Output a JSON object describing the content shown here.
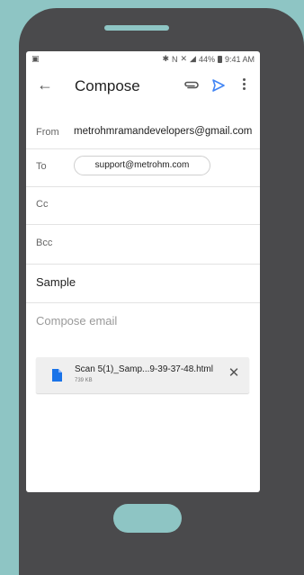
{
  "status_bar": {
    "left_icon": "screenshot-icon",
    "battery": "44%",
    "time": "9:41 AM"
  },
  "app_bar": {
    "title": "Compose",
    "icons": [
      "back-arrow-icon",
      "paperclip-icon",
      "send-icon",
      "more-vert-icon"
    ],
    "send_color": "#4285f4"
  },
  "compose": {
    "from_label": "From",
    "from_value": "metrohmramandevelopers@gmail.com",
    "to_label": "To",
    "to_chip": "support@metrohm.com",
    "cc_label": "Cc",
    "bcc_label": "Bcc",
    "subject": "Sample",
    "body_placeholder": "Compose email"
  },
  "attachment": {
    "name": "Scan 5(1)_Samp...9-39-37-48.html",
    "size": "739 KB",
    "icon_color": "#1a73e8"
  },
  "colors": {
    "background": "#8ec5c4",
    "phone_body": "#4a4a4c"
  }
}
